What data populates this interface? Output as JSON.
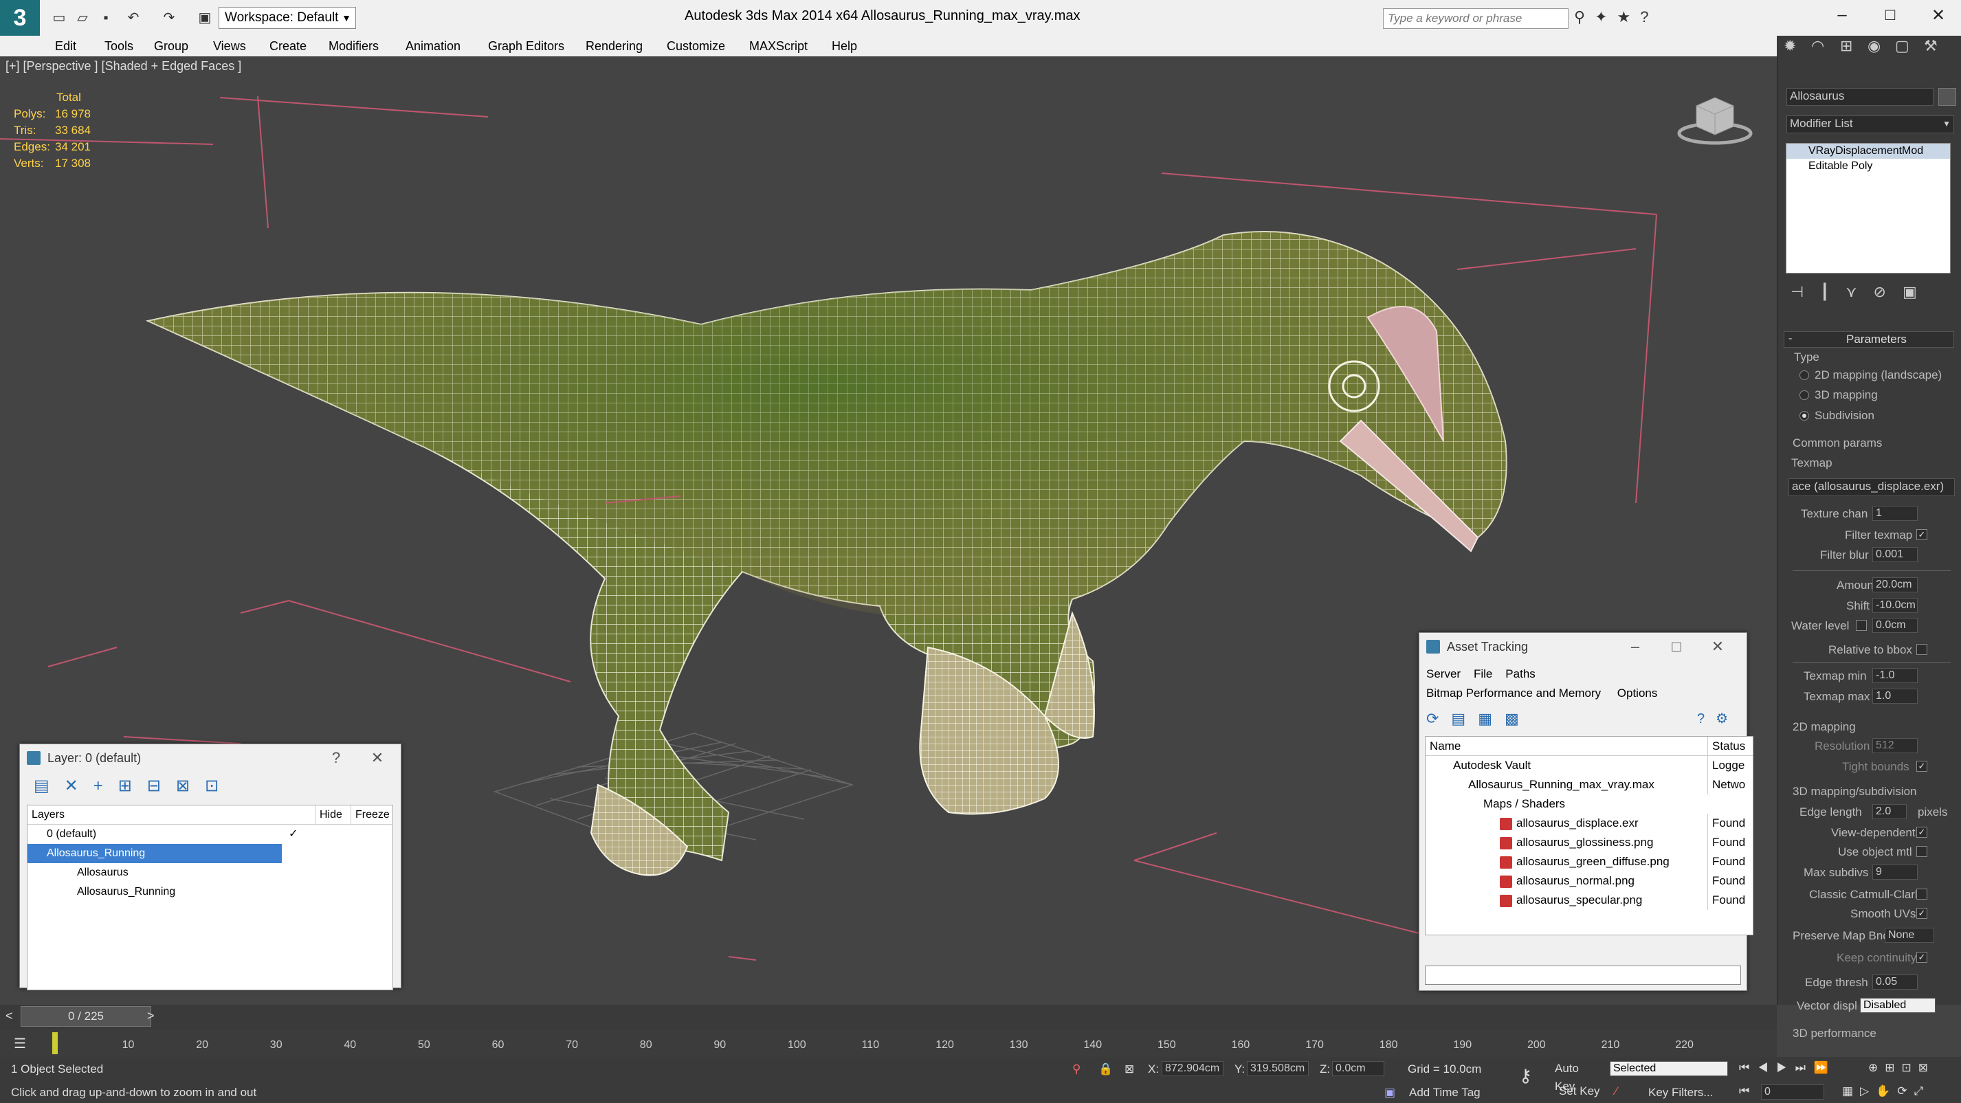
{
  "app": {
    "workspace_label": "Workspace: Default",
    "title": "Autodesk 3ds Max  2014 x64      Allosaurus_Running_max_vray.max",
    "search_placeholder": "Type a keyword or phrase"
  },
  "menu": [
    "Edit",
    "Tools",
    "Group",
    "Views",
    "Create",
    "Modifiers",
    "Animation",
    "Graph Editors",
    "Rendering",
    "Customize",
    "MAXScript",
    "Help"
  ],
  "viewport": {
    "label": "[+] [Perspective ] [Shaded + Edged Faces ]",
    "stats": {
      "header": "Total",
      "rows": [
        {
          "label": "Polys:",
          "value": "16 978"
        },
        {
          "label": "Tris:",
          "value": "33 684"
        },
        {
          "label": "Edges:",
          "value": "34 201"
        },
        {
          "label": "Verts:",
          "value": "17 308"
        }
      ]
    }
  },
  "command_panel": {
    "object_name": "Allosaurus",
    "modifier_list": "Modifier List",
    "stack": [
      "VRayDisplacementMod",
      "Editable Poly"
    ],
    "rollout_title": "Parameters",
    "type_label": "Type",
    "type_options": [
      "2D mapping (landscape)",
      "3D mapping",
      "Subdivision"
    ],
    "common_params": "Common params",
    "texmap_label": "Texmap",
    "texmap_value": "ace (allosaurus_displace.exr)",
    "texture_chan": {
      "label": "Texture chan",
      "value": "1"
    },
    "filter_texmap": "Filter texmap",
    "filter_blur": {
      "label": "Filter blur",
      "value": "0.001"
    },
    "amount": {
      "label": "Amount",
      "value": "20.0cm"
    },
    "shift": {
      "label": "Shift",
      "value": "-10.0cm"
    },
    "water_level": {
      "label": "Water level",
      "value": "0.0cm"
    },
    "relative_bbox": "Relative to bbox",
    "texmap_min": {
      "label": "Texmap min",
      "value": "-1.0"
    },
    "texmap_max": {
      "label": "Texmap max",
      "value": "1.0"
    },
    "mapping2d": "2D mapping",
    "resolution": {
      "label": "Resolution",
      "value": "512"
    },
    "tight_bounds": "Tight bounds",
    "mapping3d": "3D mapping/subdivision",
    "edge_length": {
      "label": "Edge length",
      "value": "2.0",
      "unit": "pixels"
    },
    "view_dependent": "View-dependent",
    "use_object_mtl": "Use object mtl",
    "max_subdivs": {
      "label": "Max subdivs",
      "value": "9"
    },
    "classic_catmull": "Classic Catmull-Clark",
    "smooth_uvs": "Smooth UVs",
    "preserve_map": {
      "label": "Preserve Map Bnd",
      "value": "None"
    },
    "keep_continuity": "Keep continuity",
    "edge_thresh": {
      "label": "Edge thresh",
      "value": "0.05"
    },
    "vector_displ": {
      "label": "Vector displ",
      "value": "Disabled"
    },
    "perf": "3D performance"
  },
  "layer_dialog": {
    "title": "Layer: 0 (default)",
    "columns": [
      "Layers",
      "Hide",
      "Freeze"
    ],
    "rows": [
      {
        "name": "0 (default)",
        "indent": 1
      },
      {
        "name": "Allosaurus_Running",
        "indent": 1
      },
      {
        "name": "Allosaurus",
        "indent": 2
      },
      {
        "name": "Allosaurus_Running",
        "indent": 2
      }
    ]
  },
  "asset_tracking": {
    "title": "Asset Tracking",
    "menu": [
      "Server",
      "File",
      "Paths",
      "Bitmap Performance and Memory",
      "Options"
    ],
    "columns": [
      "Name",
      "Status"
    ],
    "rows": [
      {
        "name": "Autodesk Vault",
        "status": "Logge",
        "indent": 1
      },
      {
        "name": "Allosaurus_Running_max_vray.max",
        "status": "Netwo",
        "indent": 2
      },
      {
        "name": "Maps / Shaders",
        "status": "",
        "indent": 3
      },
      {
        "name": "allosaurus_displace.exr",
        "status": "Found",
        "indent": 4
      },
      {
        "name": "allosaurus_glossiness.png",
        "status": "Found",
        "indent": 4
      },
      {
        "name": "allosaurus_green_diffuse.png",
        "status": "Found",
        "indent": 4
      },
      {
        "name": "allosaurus_normal.png",
        "status": "Found",
        "indent": 4
      },
      {
        "name": "allosaurus_specular.png",
        "status": "Found",
        "indent": 4
      }
    ]
  },
  "timeline": {
    "frame": "0 / 225",
    "ticks": [
      "10",
      "20",
      "30",
      "40",
      "50",
      "60",
      "70",
      "80",
      "90",
      "100",
      "110",
      "120",
      "130",
      "140",
      "150",
      "160",
      "170",
      "180",
      "190",
      "200",
      "210",
      "220"
    ]
  },
  "status": {
    "selection": "1 Object Selected",
    "prompt": "Click and drag up-and-down to zoom in and out",
    "x": "872.904cm",
    "y": "319.508cm",
    "z": "0.0cm",
    "grid": "Grid = 10.0cm",
    "add_time_tag": "Add Time Tag",
    "auto_key": "Auto Key",
    "set_key": "Set Key",
    "selected": "Selected",
    "key_filters": "Key Filters...",
    "frame_field": "0"
  }
}
